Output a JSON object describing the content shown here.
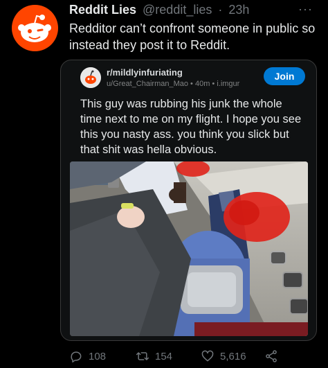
{
  "tweet": {
    "display_name": "Reddit Lies",
    "handle": "@reddit_lies",
    "separator": "·",
    "time": "23h",
    "more_icon": "more-icon",
    "text": "Redditor can’t confront someone in public so instead they post it to Reddit."
  },
  "embedded_post": {
    "subreddit": "r/mildlyinfuriating",
    "meta": "u/Great_Chairman_Mao • 40m • i.imgur",
    "join_label": "Join",
    "title": "This guy was rubbing his junk the whole time next to me on my flight. I hope you see this you nasty ass. you think you slick but that shit was hella obvious."
  },
  "actions": {
    "reply_count": "108",
    "retweet_count": "154",
    "like_count": "5,616"
  },
  "colors": {
    "background": "#000000",
    "reddit_orange": "#ff4500",
    "join_blue": "#0079d3",
    "muted_text": "#71767b"
  }
}
